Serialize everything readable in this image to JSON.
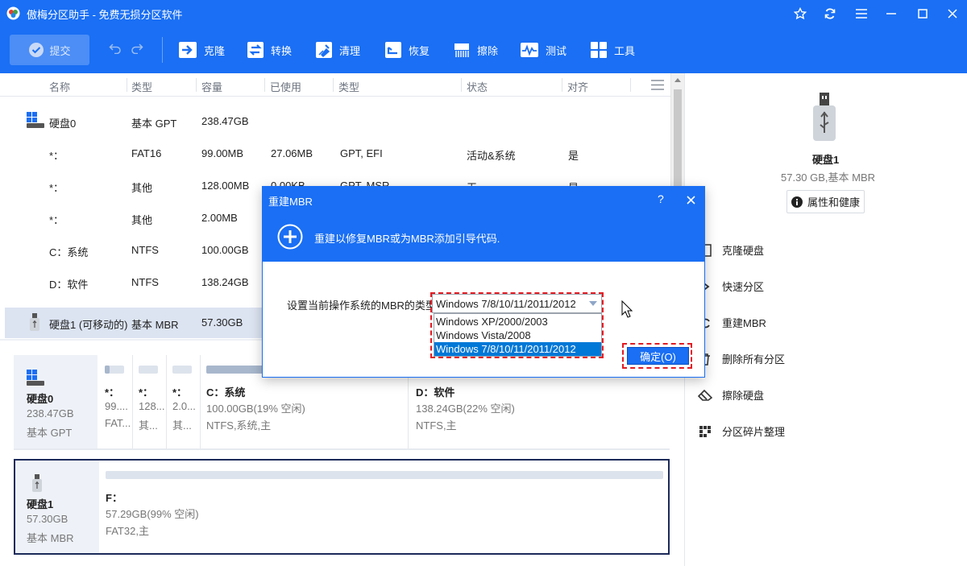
{
  "app": {
    "title": "傲梅分区助手 - 免费无损分区软件"
  },
  "toolbar": {
    "submit": "提交",
    "items": [
      "克隆",
      "转换",
      "清理",
      "恢复",
      "擦除",
      "测试",
      "工具"
    ]
  },
  "table": {
    "headers": [
      "名称",
      "类型",
      "容量",
      "已使用",
      "类型",
      "状态",
      "对齐"
    ],
    "rows": [
      {
        "name": "硬盘0",
        "type": "基本 GPT",
        "capacity": "238.47GB",
        "used": "",
        "fs": "",
        "status": "",
        "align": ""
      },
      {
        "name": "*：",
        "type": "FAT16",
        "capacity": "99.00MB",
        "used": "27.06MB",
        "fs": "GPT, EFI",
        "status": "活动&系统",
        "align": "是"
      },
      {
        "name": "*：",
        "type": "其他",
        "capacity": "128.00MB",
        "used": "0.00KB",
        "fs": "GPT, MSR",
        "status": "无",
        "align": "是"
      },
      {
        "name": "*：",
        "type": "其他",
        "capacity": "2.00MB",
        "used": "",
        "fs": "",
        "status": "",
        "align": ""
      },
      {
        "name": "C：系统",
        "type": "NTFS",
        "capacity": "100.00GB",
        "used": "",
        "fs": "",
        "status": "",
        "align": ""
      },
      {
        "name": "D：软件",
        "type": "NTFS",
        "capacity": "138.24GB",
        "used": "",
        "fs": "",
        "status": "",
        "align": ""
      },
      {
        "name": "硬盘1 (可移动的)",
        "type": "基本 MBR",
        "capacity": "57.30GB",
        "used": "",
        "fs": "",
        "status": "",
        "align": ""
      }
    ]
  },
  "disk0": {
    "name": "硬盘0",
    "size": "238.47GB",
    "kind": "基本 GPT",
    "parts": [
      {
        "label": "*：",
        "l2": "99....",
        "l3": "FAT..."
      },
      {
        "label": "*：",
        "l2": "128...",
        "l3": "其..."
      },
      {
        "label": "*：",
        "l2": "2.0...",
        "l3": "其..."
      },
      {
        "label": "C：系统",
        "l2": "100.00GB(19% 空闲)",
        "l3": "NTFS,系统,主"
      },
      {
        "label": "D：软件",
        "l2": "138.24GB(22% 空闲)",
        "l3": "NTFS,主"
      }
    ]
  },
  "disk1": {
    "name": "硬盘1",
    "size": "57.30GB",
    "kind": "基本 MBR",
    "part": {
      "label": "F：",
      "l2": "57.29GB(99% 空闲)",
      "l3": "FAT32,主"
    }
  },
  "side": {
    "disk_name": "硬盘1",
    "disk_info": "57.30 GB,基本 MBR",
    "props_btn": "属性和健康",
    "ops": [
      "克隆硬盘",
      "快速分区",
      "重建MBR",
      "删除所有分区",
      "擦除硬盘",
      "分区碎片整理"
    ]
  },
  "dialog": {
    "title": "重建MBR",
    "help": "?",
    "banner": "重建以修复MBR或为MBR添加引导代码.",
    "label": "设置当前操作系统的MBR的类型:",
    "selected": "Windows 7/8/10/11/2011/2012",
    "options": [
      "Windows XP/2000/2003",
      "Windows Vista/2008",
      "Windows 7/8/10/11/2011/2012"
    ],
    "ok": "确定(O)"
  },
  "colors": {
    "accent": "#1a6ff4",
    "highlight_box": "#e31b23",
    "selected_option": "#0078d7"
  }
}
